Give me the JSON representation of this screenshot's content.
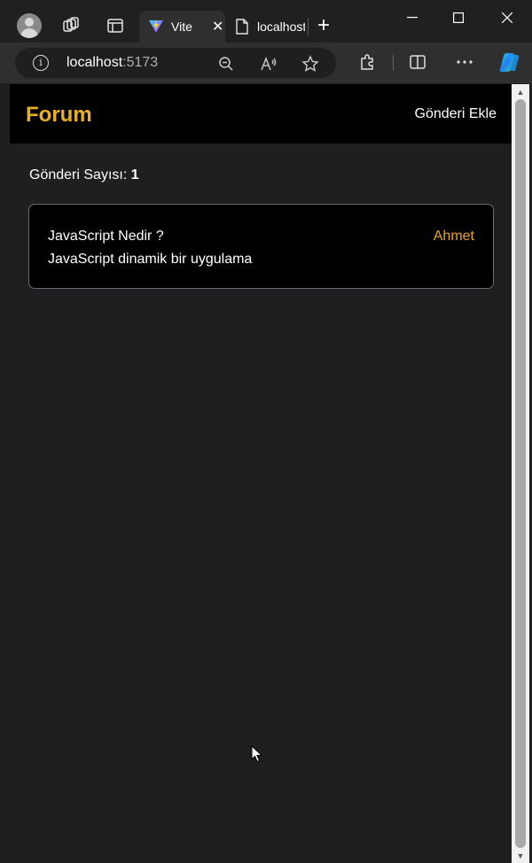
{
  "browser": {
    "tabs": [
      {
        "title": "Vite",
        "active": true,
        "close": "✕"
      },
      {
        "title": "localhost",
        "active": false
      }
    ],
    "new_tab": "+",
    "url": {
      "host": "localhost",
      "port": ":5173"
    },
    "window_controls": {
      "minimize": "—",
      "maximize": "☐",
      "close": "✕"
    },
    "icons": [
      "profile-avatar",
      "workspaces-icon",
      "tab-actions-icon",
      "vite-favicon",
      "page-favicon",
      "info-icon",
      "zoom-out-icon",
      "read-aloud-icon",
      "favorite-star-icon",
      "extensions-icon",
      "split-screen-icon",
      "more-icon",
      "copilot-icon"
    ]
  },
  "app": {
    "brand": "Forum",
    "nav_link": "Gönderi Ekle",
    "count_label": "Gönderi Sayısı:",
    "count_value": "1",
    "posts": [
      {
        "title": "JavaScript Nedir ?",
        "body": "JavaScript dinamik bir uygulama",
        "author": "Ahmet"
      }
    ]
  },
  "colors": {
    "brand": "#e8b125",
    "author": "#e8a330",
    "page_bg": "#1f1e20",
    "card_bg": "#000000",
    "navbar_bg": "#000000"
  }
}
